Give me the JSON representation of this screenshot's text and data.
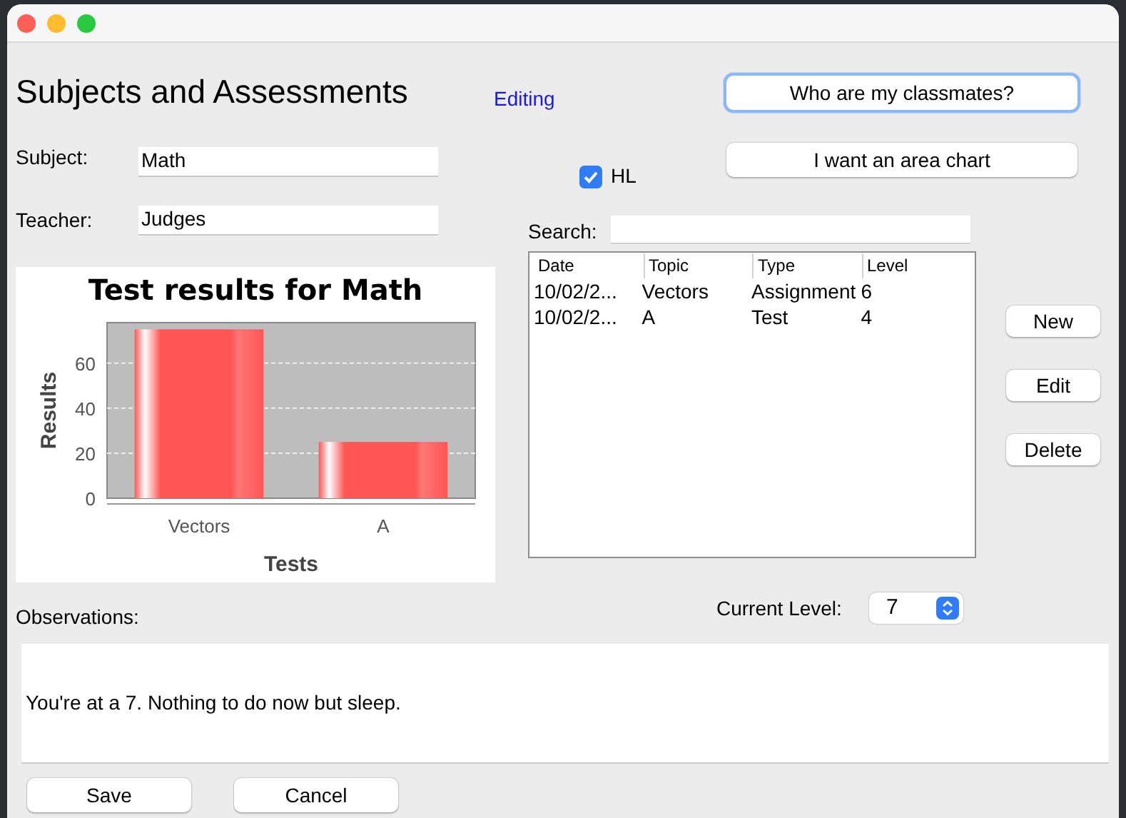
{
  "heading": "Subjects and Assessments",
  "mode": "Editing",
  "top_buttons": [
    {
      "label": "Who are my classmates?",
      "focused": true
    },
    {
      "label": "I want an area chart",
      "focused": false
    }
  ],
  "subject": {
    "label": "Subject:",
    "value": "Math"
  },
  "teacher": {
    "label": "Teacher:",
    "value": "Judges"
  },
  "hl": {
    "label": "HL",
    "checked": true
  },
  "search": {
    "label": "Search:"
  },
  "table": {
    "columns": [
      "Date",
      "Topic",
      "Type",
      "Level"
    ],
    "rows": [
      [
        "10/02/2...",
        "Vectors",
        "Assignment",
        "6"
      ],
      [
        "10/02/2...",
        "A",
        "Test",
        "4"
      ]
    ]
  },
  "side_buttons": [
    "New",
    "Edit",
    "Delete"
  ],
  "chart": {
    "chart_data": {
      "type": "bar",
      "title": "Test results for Math",
      "xlabel": "Tests",
      "ylabel": "Results",
      "categories": [
        "Vectors",
        "A"
      ],
      "series": [
        {
          "color": "#ff5555",
          "values": [
            75,
            25
          ]
        }
      ],
      "ylim": [
        0,
        78
      ],
      "yticks": [
        0,
        20,
        40,
        60
      ],
      "grid": true
    }
  },
  "observations": {
    "label": "Observations:",
    "text": "You're at a 7. Nothing to do now but sleep."
  },
  "current_level": {
    "label": "Current Level:",
    "value": "7"
  },
  "bottom_buttons": [
    "Save",
    "Cancel"
  ]
}
